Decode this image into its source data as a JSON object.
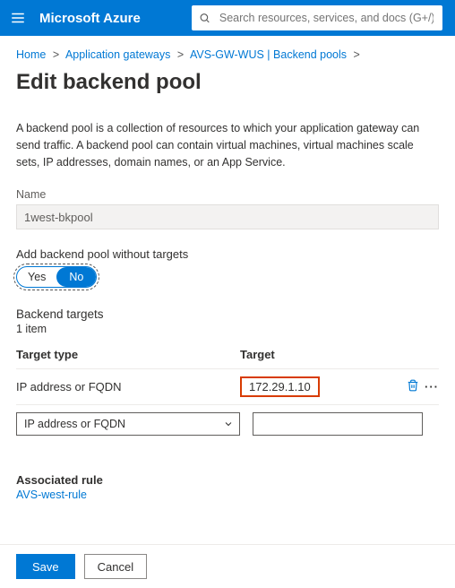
{
  "topbar": {
    "brand": "Microsoft Azure",
    "search_placeholder": "Search resources, services, and docs (G+/)"
  },
  "crumbs": {
    "home": "Home",
    "gateways": "Application gateways",
    "pool": "AVS-GW-WUS | Backend pools"
  },
  "title": "Edit backend pool",
  "description": "A backend pool is a collection of resources to which your application gateway can send traffic. A backend pool can contain virtual machines, virtual machines scale sets, IP addresses, domain names, or an App Service.",
  "name_label": "Name",
  "name_value": "1west-bkpool",
  "notargets_label": "Add backend pool without targets",
  "toggle": {
    "yes": "Yes",
    "no": "No",
    "selected": "no"
  },
  "targets_title": "Backend targets",
  "count_label": "1 item",
  "columns": {
    "type": "Target type",
    "target": "Target"
  },
  "row": {
    "type": "IP address or FQDN",
    "target": "172.29.1.10"
  },
  "select_placeholder": "IP address or FQDN",
  "rule_label": "Associated rule",
  "rule_link": "AVS-west-rule",
  "buttons": {
    "save": "Save",
    "cancel": "Cancel"
  }
}
